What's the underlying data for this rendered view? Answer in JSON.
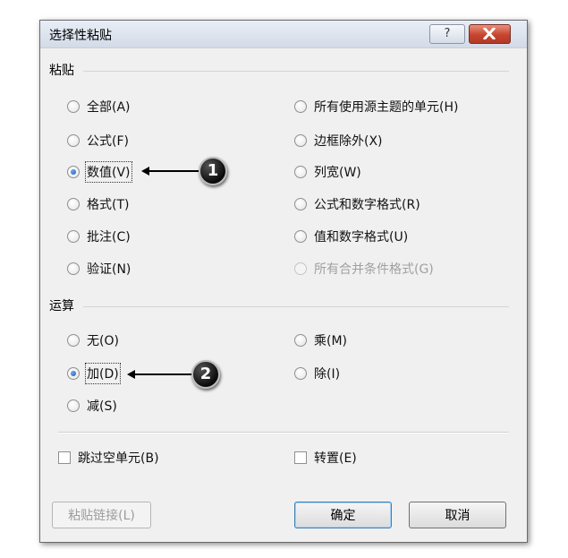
{
  "dialog": {
    "title": "选择性粘贴",
    "help_label": "?"
  },
  "paste": {
    "label": "粘贴",
    "left": [
      {
        "label": "全部(A)",
        "checked": false
      },
      {
        "label": "公式(F)",
        "checked": false
      },
      {
        "label": "数值(V)",
        "checked": true
      },
      {
        "label": "格式(T)",
        "checked": false
      },
      {
        "label": "批注(C)",
        "checked": false
      },
      {
        "label": "验证(N)",
        "checked": false
      }
    ],
    "right": [
      {
        "label": "所有使用源主题的单元(H)",
        "checked": false
      },
      {
        "label": "边框除外(X)",
        "checked": false
      },
      {
        "label": "列宽(W)",
        "checked": false
      },
      {
        "label": "公式和数字格式(R)",
        "checked": false
      },
      {
        "label": "值和数字格式(U)",
        "checked": false
      },
      {
        "label": "所有合并条件格式(G)",
        "checked": false,
        "disabled": true
      }
    ]
  },
  "operation": {
    "label": "运算",
    "left": [
      {
        "label": "无(O)",
        "checked": false
      },
      {
        "label": "加(D)",
        "checked": true
      },
      {
        "label": "减(S)",
        "checked": false
      }
    ],
    "right": [
      {
        "label": "乘(M)",
        "checked": false
      },
      {
        "label": "除(I)",
        "checked": false
      }
    ]
  },
  "options": {
    "skip_blanks": "跳过空单元(B)",
    "transpose": "转置(E)"
  },
  "buttons": {
    "paste_link": "粘贴链接(L)",
    "ok": "确定",
    "cancel": "取消"
  },
  "callouts": {
    "one": "1",
    "two": "2"
  }
}
